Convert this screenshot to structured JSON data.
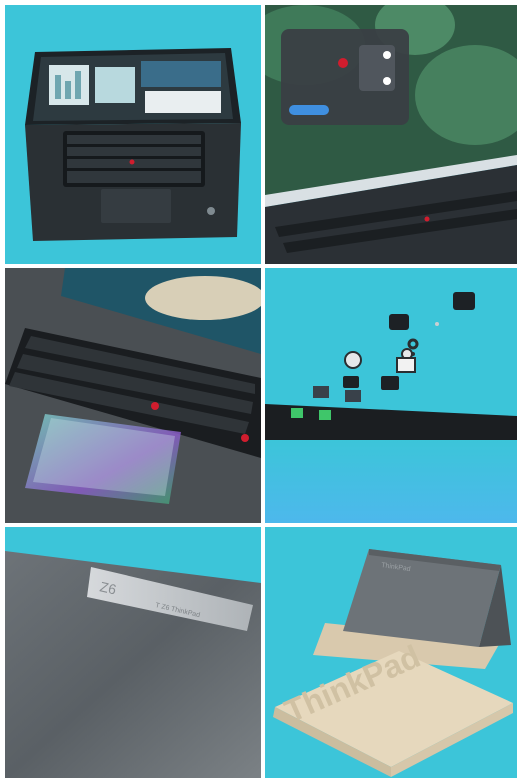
{
  "background_color": "#3cc5d9",
  "tiles": [
    {
      "name": "laptop-top-view"
    },
    {
      "name": "laptop-screen-quick-settings"
    },
    {
      "name": "touchpad-haptic-closeup"
    },
    {
      "name": "camera-module-exploded"
    },
    {
      "name": "lid-logo-closeup"
    },
    {
      "name": "laptop-with-molded-packaging"
    }
  ],
  "lid_badge": {
    "letters": "Z6",
    "caption": "T Z6 ThinkPad"
  },
  "packaging": {
    "embossed_text": "ThinkPad"
  }
}
